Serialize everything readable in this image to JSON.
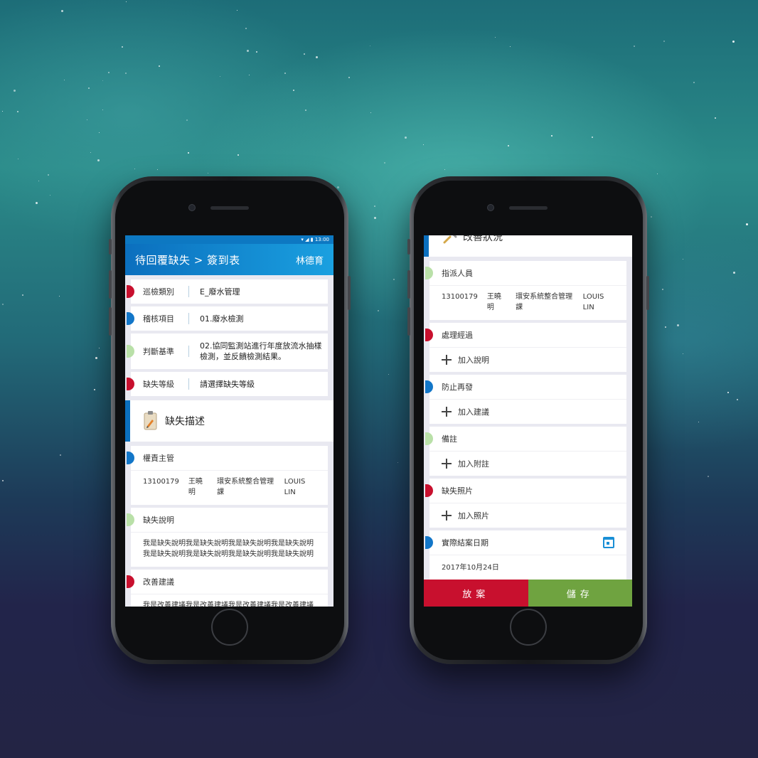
{
  "left": {
    "status": {
      "time": "13:00"
    },
    "appbar": {
      "title": "待回覆缺失 > 簽到表",
      "user": "林德育"
    },
    "fields": [
      {
        "label": "巡檢類別",
        "value": "E_廢水管理",
        "color": "#c8102e"
      },
      {
        "label": "稽核項目",
        "value": "01.廢水檢測",
        "color": "#1276c8"
      },
      {
        "label": "判斷基準",
        "value": "02.協同監測站進行年度放流水抽樣檢測，並反饋檢測結果。",
        "color": "#b9e0a8"
      },
      {
        "label": "缺失等級",
        "value": "請選擇缺失等級",
        "color": "#c8102e"
      }
    ],
    "section_title": "缺失描述",
    "responsible": {
      "label": "權責主管",
      "id": "13100179",
      "name": "王曉明",
      "dept": "環安系統整合管理課",
      "en_name": "LOUIS LIN"
    },
    "description": {
      "label": "缺失說明",
      "text": "我是缺失說明我是缺失說明我是缺失說明我是缺失說明我是缺失說明我是缺失說明我是缺失說明我是缺失說明"
    },
    "improvement": {
      "label": "改善建議",
      "text": "我是改善建議我是改善建議我是改善建議我是改善建議我是改善建議我是改善建議我是改善建議我是改善建議"
    }
  },
  "right": {
    "section_title": "改善狀況",
    "assigned": {
      "label": "指派人員",
      "id": "13100179",
      "name": "王曉明",
      "dept": "環安系統整合管理課",
      "en_name": "LOUIS LIN"
    },
    "process": {
      "label": "處理經過",
      "add": "加入說明"
    },
    "prevent": {
      "label": "防止再發",
      "add": "加入建議"
    },
    "remark": {
      "label": "備註",
      "add": "加入附註"
    },
    "photo": {
      "label": "缺失照片",
      "add": "加入照片"
    },
    "close_date": {
      "label": "實際結案日期",
      "value": "2017年10月24日"
    },
    "actions": {
      "cancel": "放案",
      "save": "儲存"
    }
  },
  "colors": {
    "primary": "#0b6fbe",
    "danger": "#c8102e",
    "success": "#6fa340",
    "accent_green": "#b9e0a8"
  }
}
